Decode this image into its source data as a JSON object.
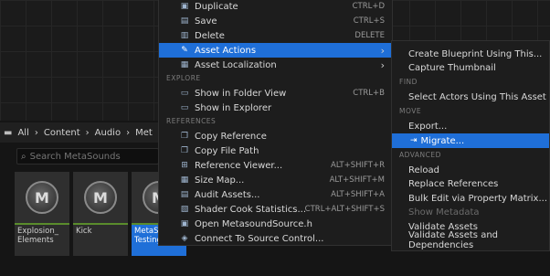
{
  "breadcrumb": {
    "items": [
      "All",
      "Content",
      "Audio",
      "Met"
    ]
  },
  "search": {
    "placeholder": "Search MetaSounds"
  },
  "tiles": [
    {
      "label": "Explosion_ Elements"
    },
    {
      "label": "Kick"
    },
    {
      "label": "MetaSo Testing"
    }
  ],
  "context_menu": {
    "items": [
      {
        "label": "Duplicate",
        "shortcut": "CTRL+D",
        "icon": "duplicate-icon"
      },
      {
        "label": "Save",
        "shortcut": "CTRL+S",
        "icon": "save-icon"
      },
      {
        "label": "Delete",
        "shortcut": "DELETE",
        "icon": "delete-icon"
      },
      {
        "label": "Asset Actions",
        "icon": "wrench-icon",
        "submenu": true,
        "highlighted": true
      },
      {
        "label": "Asset Localization",
        "icon": "localization-icon",
        "submenu": true
      }
    ],
    "section_explore": "EXPLORE",
    "explore_items": [
      {
        "label": "Show in Folder View",
        "shortcut": "CTRL+B",
        "icon": "folder-icon"
      },
      {
        "label": "Show in Explorer",
        "icon": "explorer-icon"
      }
    ],
    "section_references": "REFERENCES",
    "reference_items": [
      {
        "label": "Copy Reference",
        "icon": "copy-icon"
      },
      {
        "label": "Copy File Path",
        "icon": "file-path-icon"
      },
      {
        "label": "Reference Viewer...",
        "shortcut": "ALT+SHIFT+R",
        "icon": "reference-viewer-icon"
      },
      {
        "label": "Size Map...",
        "shortcut": "ALT+SHIFT+M",
        "icon": "size-map-icon"
      },
      {
        "label": "Audit Assets...",
        "shortcut": "ALT+SHIFT+A",
        "icon": "audit-icon"
      },
      {
        "label": "Shader Cook Statistics...",
        "shortcut": "CTRL+ALT+SHIFT+S",
        "icon": "shader-stats-icon"
      },
      {
        "label": "Open MetasoundSource.h",
        "icon": "source-file-icon"
      },
      {
        "label": "Connect To Source Control...",
        "icon": "source-control-icon"
      }
    ]
  },
  "submenu": {
    "items": [
      {
        "label": "Create Blueprint Using This..."
      },
      {
        "label": "Capture Thumbnail"
      }
    ],
    "section_find": "FIND",
    "find_items": [
      {
        "label": "Select Actors Using This Asset"
      }
    ],
    "section_move": "MOVE",
    "move_items": [
      {
        "label": "Export..."
      },
      {
        "label": "Migrate...",
        "highlighted": true
      }
    ],
    "section_advanced": "ADVANCED",
    "advanced_items": [
      {
        "label": "Reload"
      },
      {
        "label": "Replace References"
      },
      {
        "label": "Bulk Edit via Property Matrix..."
      },
      {
        "label": "Show Metadata",
        "disabled": true
      },
      {
        "label": "Validate Assets"
      },
      {
        "label": "Validate Assets and Dependencies"
      }
    ]
  },
  "colors": {
    "accent": "#1f6fd8",
    "menu_bg": "#1d1d1d",
    "asset_strip": "#5a8c2c"
  }
}
